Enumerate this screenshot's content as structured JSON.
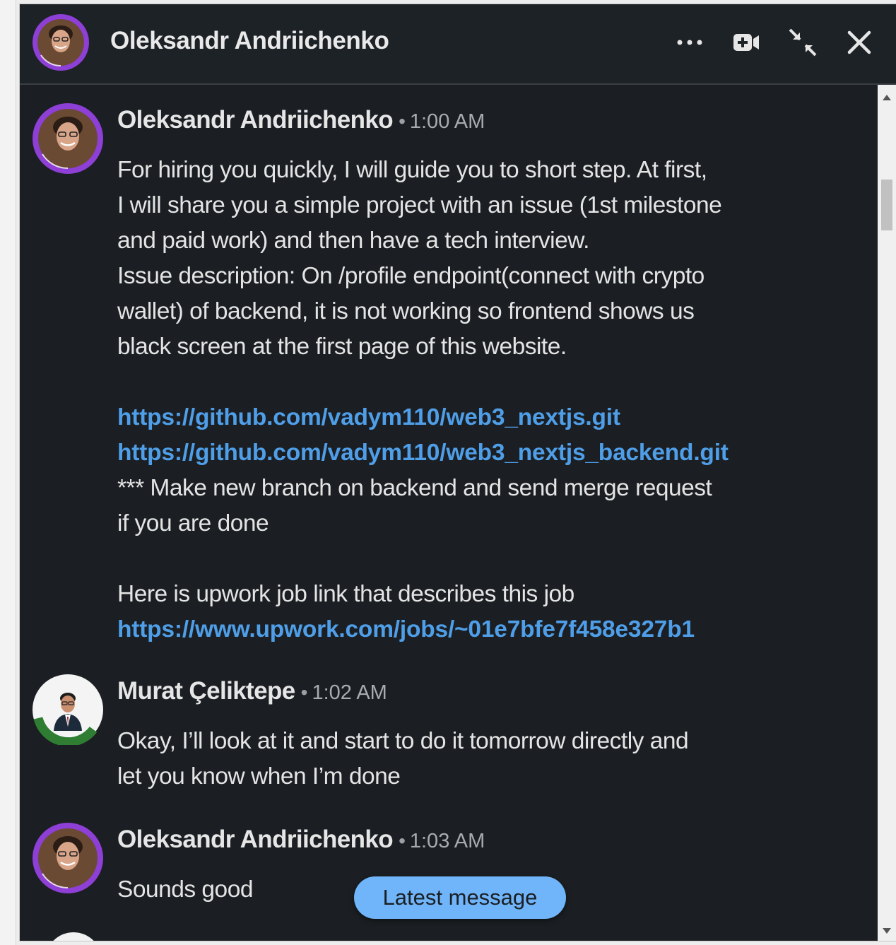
{
  "conversation": {
    "title": "Oleksandr Andriichenko"
  },
  "header_actions": {
    "more_icon": "ellipsis-icon",
    "video_icon": "video-call-icon",
    "minimize_icon": "collapse-arrows-icon",
    "close_icon": "close-icon"
  },
  "messages": [
    {
      "sender": "Oleksandr Andriichenko",
      "separator": "•",
      "time": "1:00 AM",
      "lines": [
        "For hiring you quickly, I will guide you to short step. At first,",
        "I will share you a simple project with an issue (1st milestone",
        "and paid work) and then have a tech interview.",
        "Issue description: On /profile endpoint(connect with crypto",
        "wallet) of backend, it is not working so frontend shows us",
        "black screen at the first page of this website."
      ],
      "link1": "https://github.com/vadym110/web3_nextjs.git",
      "link2": "https://github.com/vadym110/web3_nextjs_backend.git",
      "note_line1": "*** Make new branch on backend and send merge request",
      "note_line2": "if you are done",
      "job_text": "Here is upwork job link that describes this job",
      "link3": "https://www.upwork.com/jobs/~01e7bfe7f458e327b1"
    },
    {
      "sender": "Murat Çeliktepe",
      "separator": "•",
      "time": "1:02 AM",
      "lines": [
        "Okay, I’ll look at it and start to do it tomorrow directly and",
        "let you know when I’m done"
      ]
    },
    {
      "sender": "Oleksandr Andriichenko",
      "separator": "•",
      "time": "1:03 AM",
      "lines": [
        "Sounds good"
      ]
    }
  ],
  "latest_message_button": "Latest message",
  "colors": {
    "background": "#1b1f23",
    "link": "#4f9ee8",
    "button": "#70b5f9",
    "hiring_ring": "#8e3fd6",
    "open_to_work_ring": "#2e7d32"
  }
}
